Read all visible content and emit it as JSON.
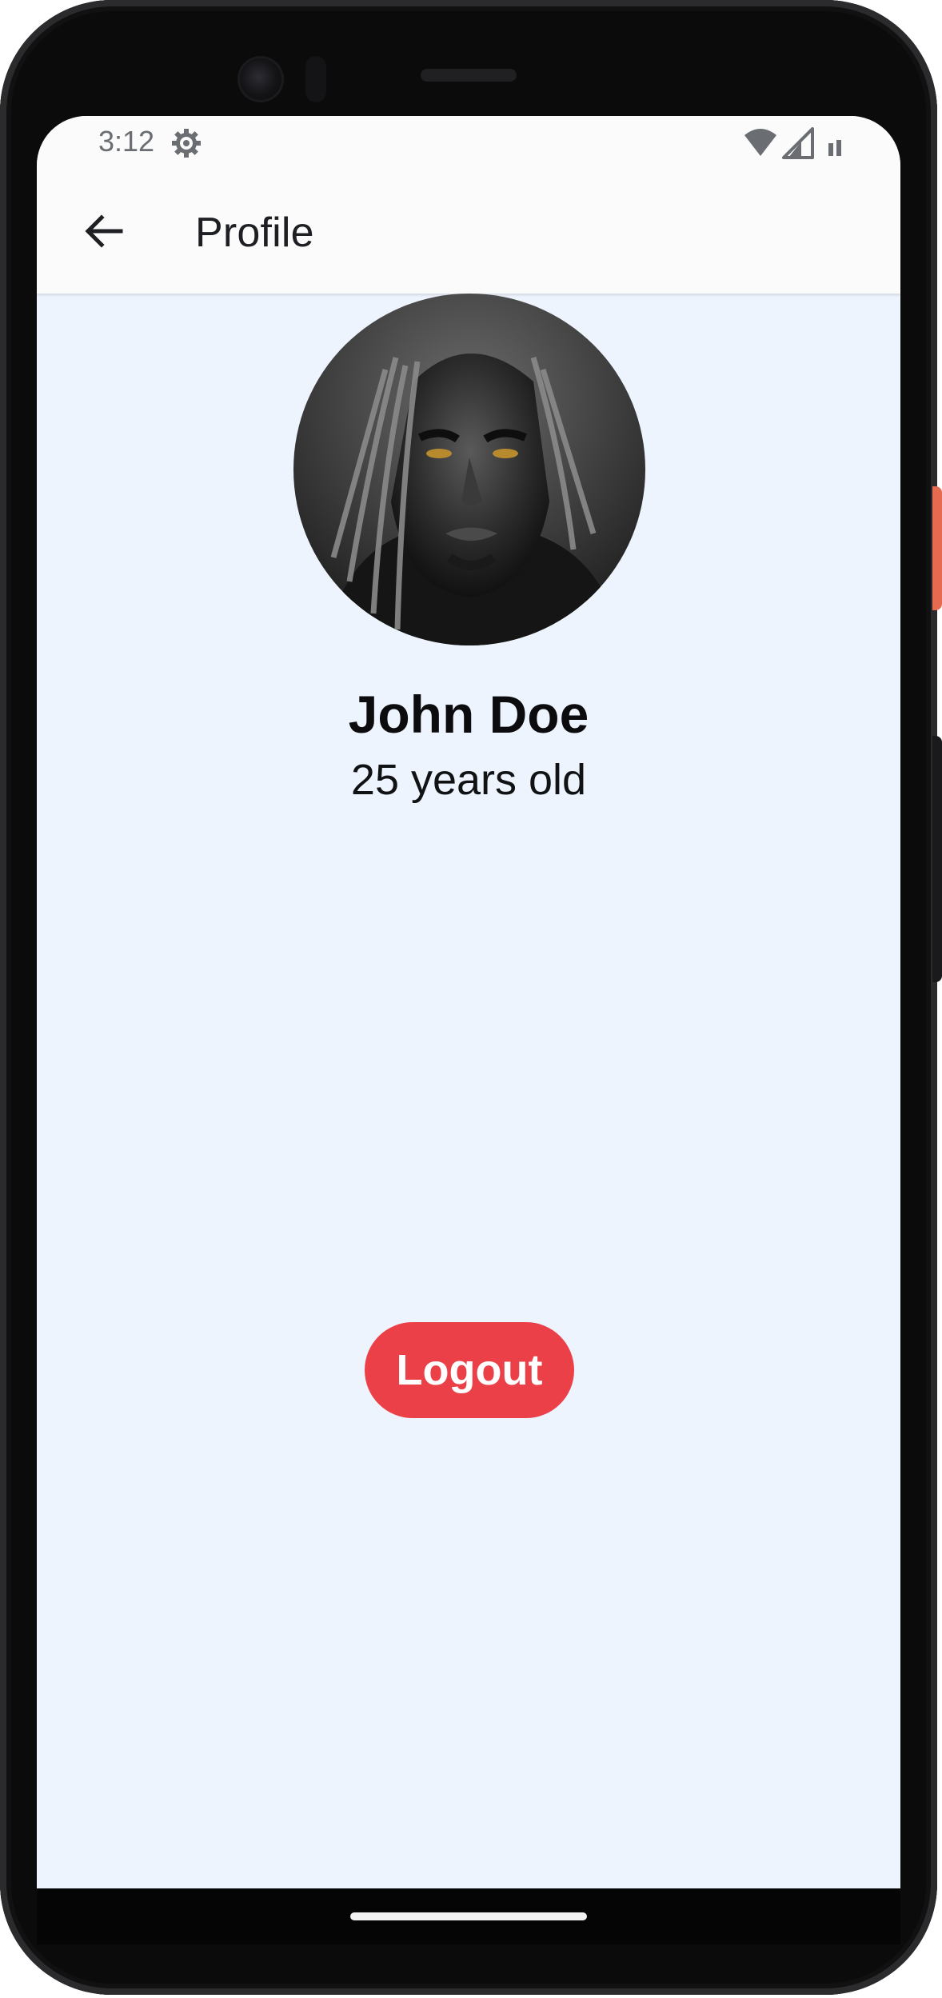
{
  "status_bar": {
    "time": "3:12",
    "icons": [
      "settings-gear-icon",
      "wifi-icon",
      "cell-signal-icon",
      "battery-icon"
    ]
  },
  "app_bar": {
    "back_icon": "arrow-back-icon",
    "title": "Profile"
  },
  "profile": {
    "avatar": "avatar-portrait",
    "name": "John Doe",
    "age": "25 years old"
  },
  "actions": {
    "logout_label": "Logout"
  },
  "colors": {
    "screen_background": "#eef4fd",
    "app_bar_background": "#fbfbfc",
    "logout_button": "#ec4049",
    "logout_text": "#ffffff"
  }
}
